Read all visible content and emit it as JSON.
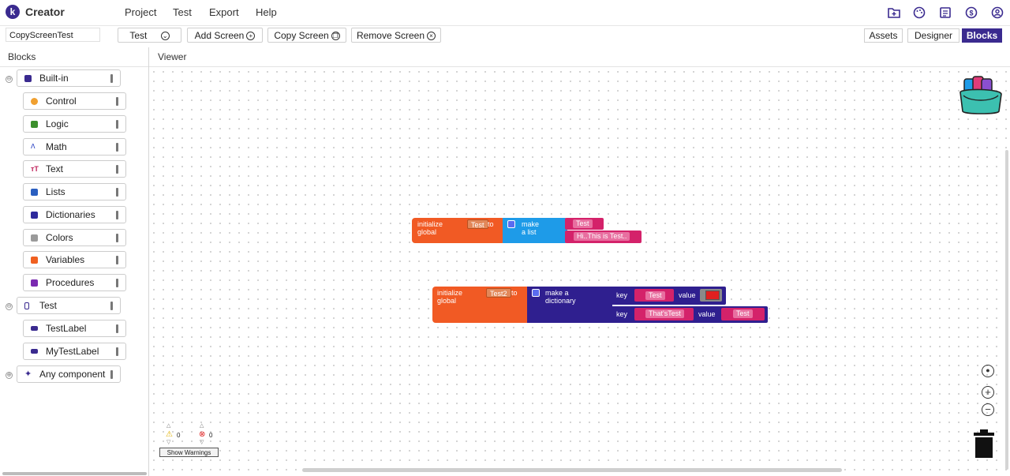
{
  "app": {
    "logo_letter": "k",
    "brand": "Creator"
  },
  "menu": [
    "Project",
    "Test",
    "Export",
    "Help"
  ],
  "top_icons": [
    "folder-icon",
    "palette-icon",
    "book-icon",
    "dollar-icon",
    "account-icon"
  ],
  "toolbar": {
    "project_name": "CopyScreenTest",
    "screen_select": "Test",
    "add_screen": "Add Screen",
    "copy_screen": "Copy Screen",
    "remove_screen": "Remove Screen",
    "views": [
      "Assets",
      "Designer",
      "Blocks"
    ],
    "active_view": "Blocks"
  },
  "panels": {
    "blocks_title": "Blocks",
    "viewer_title": "Viewer"
  },
  "tree": {
    "builtin": {
      "label": "Built-in",
      "toggle": "⊖",
      "items": [
        {
          "label": "Control",
          "color": "#f0a030"
        },
        {
          "label": "Logic",
          "color": "#3b8f2c"
        },
        {
          "label": "Math",
          "color": "#3a50c8"
        },
        {
          "label": "Text",
          "color": "#c0245c"
        },
        {
          "label": "Lists",
          "color": "#2a5fc0"
        },
        {
          "label": "Dictionaries",
          "color": "#2e2a9c"
        },
        {
          "label": "Colors",
          "color": "#7a7a7a"
        },
        {
          "label": "Variables",
          "color": "#f06020"
        },
        {
          "label": "Procedures",
          "color": "#7a2ab0"
        }
      ]
    },
    "screen": {
      "label": "Test",
      "toggle": "⊖",
      "items": [
        {
          "label": "TestLabel"
        },
        {
          "label": "MyTestLabel"
        }
      ]
    },
    "any": {
      "label": "Any component",
      "toggle": "⊕"
    }
  },
  "blocks": {
    "block1": {
      "init_text": "initialize global",
      "var_name": "Test",
      "to_text": "to",
      "make_list": "make a list",
      "items": [
        "Test",
        "Hi..This is Test.."
      ]
    },
    "block2": {
      "init_text": "initialize global",
      "var_name": "Test2",
      "to_text": "to",
      "make_dict": "make a dictionary",
      "key_text": "key",
      "value_text": "value",
      "pair1_key": "Test",
      "pair2_key": "That'sTest",
      "pair2_value": "Test"
    }
  },
  "colors": {
    "accent": "#3a2a8f",
    "variable_orange": "#f15a24",
    "list_blue": "#1e9be8",
    "dict_purple": "#2f1f8f",
    "text_pink": "#d4226a",
    "color_red": "#e02020"
  },
  "warnings": {
    "warn_count": "0",
    "error_count": "0",
    "show_warnings": "Show Warnings"
  }
}
